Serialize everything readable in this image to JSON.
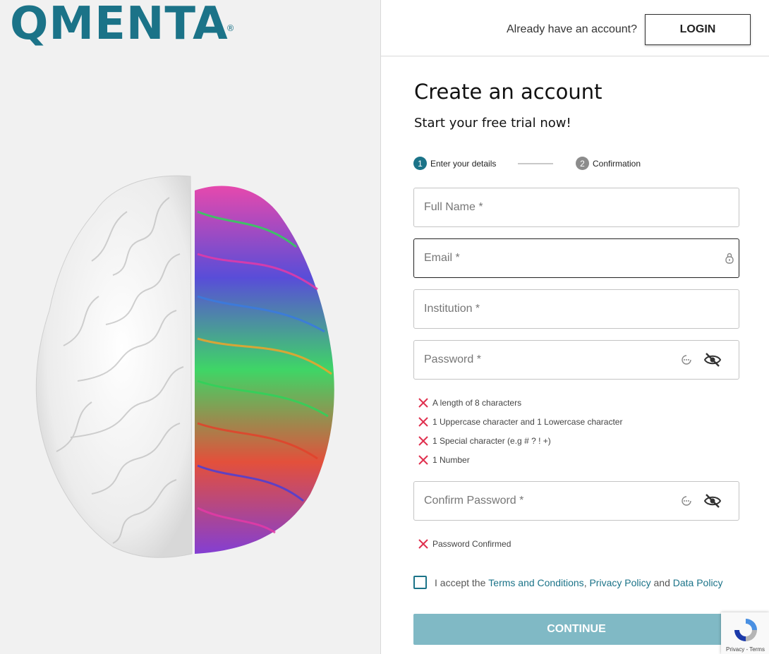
{
  "brand": {
    "name": "QMENTA",
    "mark": "®",
    "color": "#1b7388"
  },
  "header": {
    "question": "Already have an account?",
    "login_label": "LOGIN"
  },
  "form": {
    "title": "Create an account",
    "subtitle": "Start your free trial now!",
    "steps": [
      {
        "number": "1",
        "label": "Enter your details",
        "state": "active"
      },
      {
        "number": "2",
        "label": "Confirmation",
        "state": "inactive"
      }
    ],
    "fields": {
      "full_name": {
        "placeholder": "Full Name *",
        "value": ""
      },
      "email": {
        "placeholder": "Email *",
        "value": ""
      },
      "institution": {
        "placeholder": "Institution *",
        "value": ""
      },
      "password": {
        "placeholder": "Password *",
        "value": ""
      },
      "confirm_password": {
        "placeholder": "Confirm Password *",
        "value": ""
      }
    },
    "password_rules": [
      "A length of 8 characters",
      "1 Uppercase character and 1 Lowercase character",
      "1 Special character (e.g # ? ! +)",
      "1 Number"
    ],
    "confirm_rules": [
      "Password Confirmed"
    ],
    "terms": {
      "prefix": "I accept the",
      "terms_link": "Terms and Conditions",
      "sep": ",",
      "privacy_link": "Privacy Policy",
      "and": "and",
      "data_link": "Data Policy"
    },
    "continue_label": "CONTINUE"
  },
  "recaptcha": {
    "text": "Privacy - Terms"
  },
  "colors": {
    "accent": "#1b7388",
    "error": "#e0304e",
    "continue_disabled": "#80b9c5"
  },
  "icons": [
    "password-manager-icon",
    "key-dots-icon",
    "eye-off-icon",
    "error-x-icon",
    "recaptcha-icon"
  ]
}
